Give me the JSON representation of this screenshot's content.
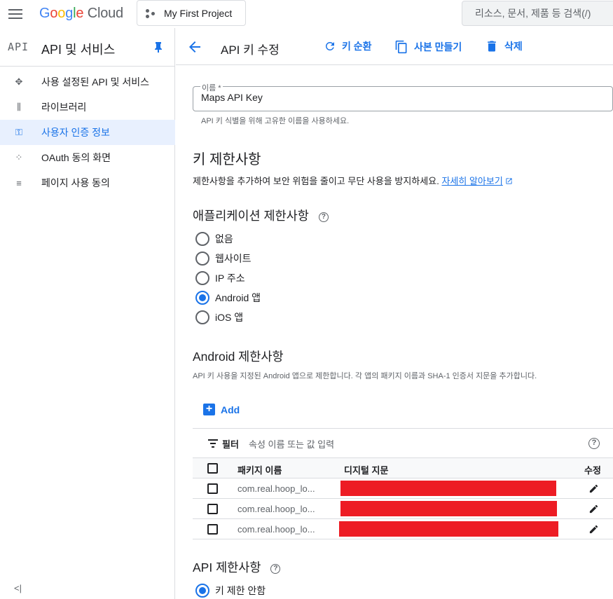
{
  "topbar": {
    "logo_letters": [
      "G",
      "o",
      "o",
      "g",
      "l",
      "e"
    ],
    "logo_suffix": "Cloud",
    "project": "My First Project",
    "search_placeholder": "리소스, 문서, 제품 등 검색(/)"
  },
  "sidebar": {
    "badge": "API",
    "title": "API 및 서비스",
    "items": [
      {
        "label": "사용 설정된 API 및 서비스",
        "icon": "diamond-arrows-icon",
        "glyph": "✥"
      },
      {
        "label": "라이브러리",
        "icon": "library-icon",
        "glyph": "⫼"
      },
      {
        "label": "사용자 인증 정보",
        "icon": "key-icon",
        "glyph": "⚿",
        "active": true
      },
      {
        "label": "OAuth 동의 화면",
        "icon": "dots-grid-icon",
        "glyph": "⁘"
      },
      {
        "label": "페이지 사용 동의",
        "icon": "list-settings-icon",
        "glyph": "≡"
      }
    ],
    "collapse": "<|"
  },
  "header": {
    "title": "API 키 수정",
    "rotate_label": "키 순환",
    "copy_label": "사본 만들기",
    "delete_label": "삭제"
  },
  "name_field": {
    "label": "이름 *",
    "value": "Maps API Key",
    "helper": "API 키 식별을 위해 고유한 이름을 사용하세요."
  },
  "key_restrictions": {
    "title": "키 제한사항",
    "desc": "제한사항을 추가하여 보안 위험을 줄이고 무단 사용을 방지하세요.",
    "link": "자세히 알아보기"
  },
  "app_restrictions": {
    "title": "애플리케이션 제한사항",
    "options": [
      "없음",
      "웹사이트",
      "IP 주소",
      "Android 앱",
      "iOS 앱"
    ],
    "selected": "Android 앱"
  },
  "android": {
    "title": "Android 제한사항",
    "desc": "API 키 사용을 지정된 Android 앱으로 제한합니다. 각 앱의 패키지 이름과 SHA-1 인증서 지문을 추가합니다.",
    "add_label": "Add",
    "filter_label": "필터",
    "filter_placeholder": "속성 이름 또는 값 입력",
    "columns": [
      "패키지 이름",
      "디지털 지문",
      "수정"
    ],
    "rows": [
      {
        "package": "com.real.hoop_lo...",
        "fingerprint": "(redacted)"
      },
      {
        "package": "com.real.hoop_lo...",
        "fingerprint": "(redacted)"
      },
      {
        "package": "com.real.hoop_lo...",
        "fingerprint": "(redacted)"
      }
    ]
  },
  "api_restrictions": {
    "title": "API 제한사항",
    "option": "키 제한 안함"
  },
  "colors": {
    "accent": "#1a73e8",
    "redaction": "#ed1c24",
    "active_bg": "#e8f0fe"
  }
}
